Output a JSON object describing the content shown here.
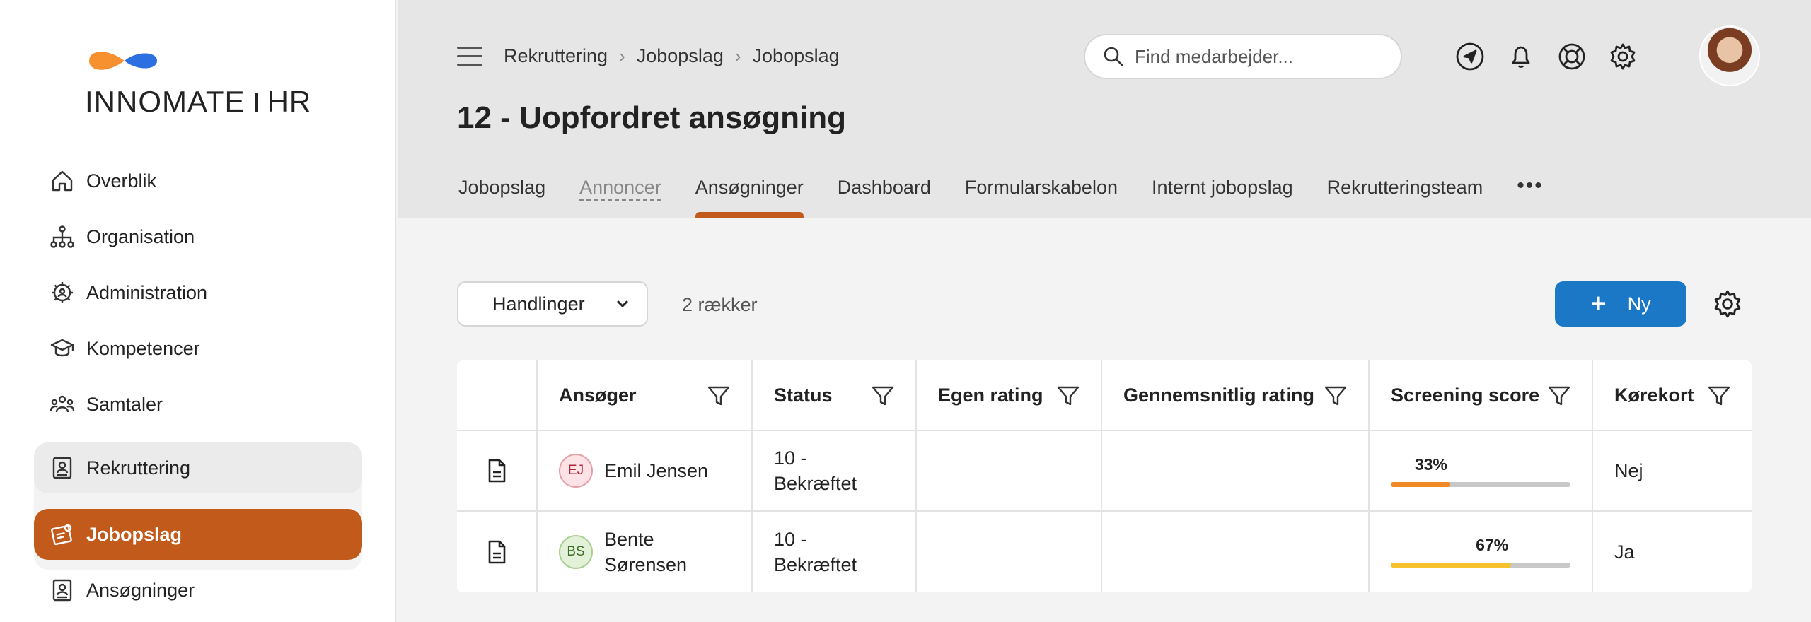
{
  "logo": {
    "part1": "INNO",
    "part2": "MATE",
    "part3": "HR"
  },
  "sidebar": {
    "items": [
      {
        "label": "Overblik",
        "icon": "home-icon"
      },
      {
        "label": "Organisation",
        "icon": "org-chart-icon"
      },
      {
        "label": "Administration",
        "icon": "gear-user-icon"
      },
      {
        "label": "Kompetencer",
        "icon": "graduation-cap-icon"
      },
      {
        "label": "Samtaler",
        "icon": "people-icon"
      },
      {
        "label": "Rekruttering",
        "icon": "badge-icon"
      },
      {
        "label": "Jobopslag",
        "icon": "job-post-icon"
      },
      {
        "label": "Ansøgninger",
        "icon": "badge-icon"
      }
    ]
  },
  "header": {
    "breadcrumbs": [
      "Rekruttering",
      "Jobopslag",
      "Jobopslag"
    ],
    "search_placeholder": "Find medarbejder...",
    "title": "12 - Uopfordret ansøgning",
    "tabs": [
      "Jobopslag",
      "Annoncer",
      "Ansøgninger",
      "Dashboard",
      "Formularskabelon",
      "Internt jobopslag",
      "Rekrutteringsteam"
    ],
    "more": "•••"
  },
  "toolbar": {
    "actions_label": "Handlinger",
    "rows_count": "2 rækker",
    "new_label": "Ny"
  },
  "table": {
    "columns": [
      "Ansøger",
      "Status",
      "Egen rating",
      "Gennemsnitlig rating",
      "Screening score",
      "Kørekort"
    ],
    "rows": [
      {
        "initials": "EJ",
        "name": "Emil Jensen",
        "status": "10 - Bekræftet",
        "own_rating": "",
        "avg_rating": "",
        "score_label": "33%",
        "score": 33,
        "score_color": "#f08a24",
        "license": "Nej"
      },
      {
        "initials": "BS",
        "name": "Bente Sørensen",
        "status": "10 - Bekræftet",
        "own_rating": "",
        "avg_rating": "",
        "score_label": "67%",
        "score": 67,
        "score_color": "#f6c12c",
        "license": "Ja"
      }
    ]
  },
  "colors": {
    "accent": "#c25a1c",
    "primary": "#1a78c6",
    "logo_orange": "#f79130",
    "logo_blue": "#2b6fe0"
  }
}
